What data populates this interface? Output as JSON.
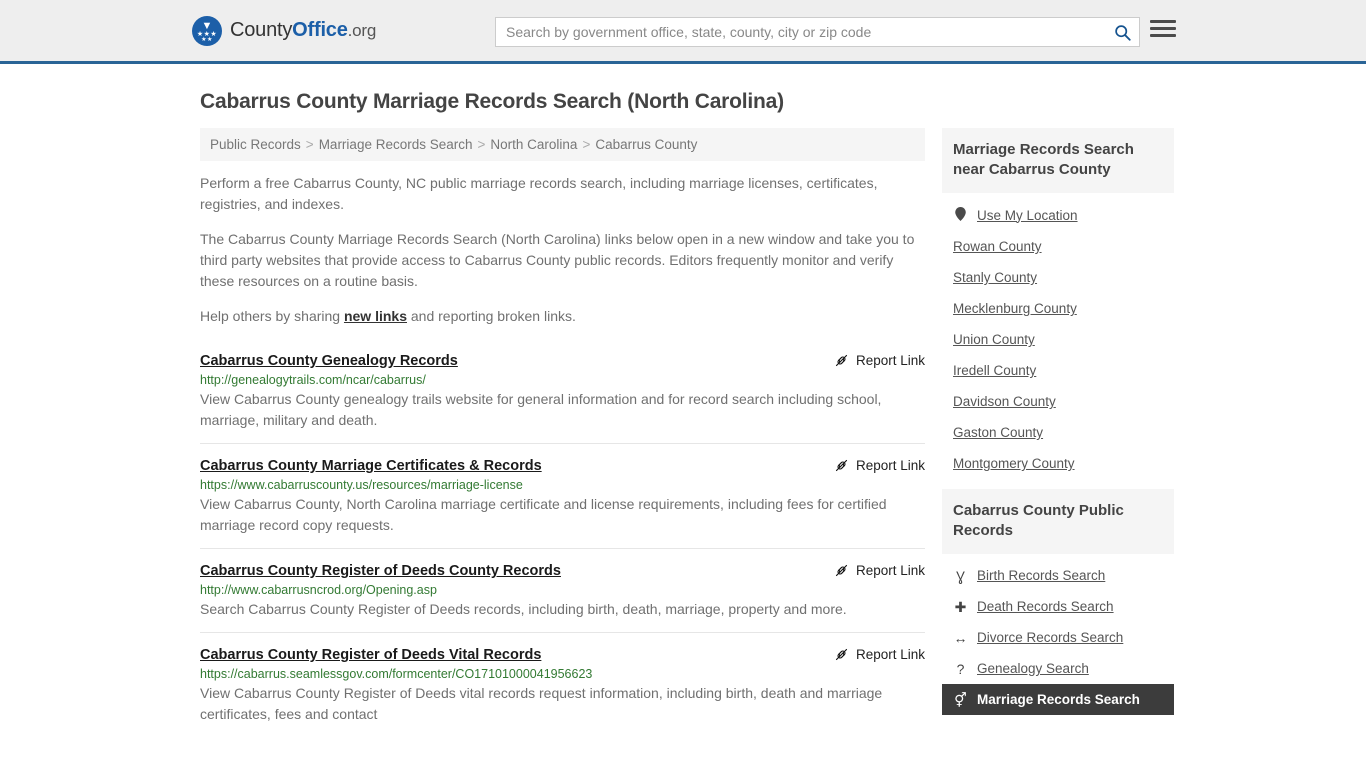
{
  "header": {
    "brand": {
      "part1": "County",
      "part2": "Office",
      "tld": ".org"
    },
    "search": {
      "placeholder": "Search by government office, state, county, city or zip code",
      "value": ""
    },
    "menu_icon": "hamburger-icon",
    "search_icon": "search-icon"
  },
  "page": {
    "title": "Cabarrus County Marriage Records Search (North Carolina)"
  },
  "breadcrumb": {
    "items": [
      {
        "label": "Public Records"
      },
      {
        "label": "Marriage Records Search"
      },
      {
        "label": "North Carolina"
      },
      {
        "label": "Cabarrus County"
      }
    ],
    "separator": ">"
  },
  "intro": {
    "p1": "Perform a free Cabarrus County, NC public marriage records search, including marriage licenses, certificates, registries, and indexes.",
    "p2": "The Cabarrus County Marriage Records Search (North Carolina) links below open in a new window and take you to third party websites that provide access to Cabarrus County public records. Editors frequently monitor and verify these resources on a routine basis.",
    "p3_before": "Help others by sharing ",
    "p3_link": "new links",
    "p3_after": " and reporting broken links."
  },
  "results": {
    "report_label": "Report Link",
    "report_icon": "unlink-icon",
    "items": [
      {
        "title": "Cabarrus County Genealogy Records",
        "url": "http://genealogytrails.com/ncar/cabarrus/",
        "desc": "View Cabarrus County genealogy trails website for general information and for record search including school, marriage, military and death."
      },
      {
        "title": "Cabarrus County Marriage Certificates & Records",
        "url": "https://www.cabarruscounty.us/resources/marriage-license",
        "desc": "View Cabarrus County, North Carolina marriage certificate and license requirements, including fees for certified marriage record copy requests."
      },
      {
        "title": "Cabarrus County Register of Deeds County Records",
        "url": "http://www.cabarrusncrod.org/Opening.asp",
        "desc": "Search Cabarrus County Register of Deeds records, including birth, death, marriage, property and more."
      },
      {
        "title": "Cabarrus County Register of Deeds Vital Records",
        "url": "https://cabarrus.seamlessgov.com/formcenter/CO17101000041956623",
        "desc": "View Cabarrus County Register of Deeds vital records request information, including birth, death and marriage certificates, fees and contact"
      }
    ]
  },
  "sidebar": {
    "nearby": {
      "heading": "Marriage Records Search near Cabarrus County",
      "items": [
        {
          "label": "Use My Location",
          "icon": "map-pin-icon",
          "glyph": "•",
          "active": false
        },
        {
          "label": "Rowan County",
          "icon": "",
          "glyph": "",
          "active": false
        },
        {
          "label": "Stanly County",
          "icon": "",
          "glyph": "",
          "active": false
        },
        {
          "label": "Mecklenburg County",
          "icon": "",
          "glyph": "",
          "active": false
        },
        {
          "label": "Union County",
          "icon": "",
          "glyph": "",
          "active": false
        },
        {
          "label": "Iredell County",
          "icon": "",
          "glyph": "",
          "active": false
        },
        {
          "label": "Davidson County",
          "icon": "",
          "glyph": "",
          "active": false
        },
        {
          "label": "Gaston County",
          "icon": "",
          "glyph": "",
          "active": false
        },
        {
          "label": "Montgomery County",
          "icon": "",
          "glyph": "",
          "active": false
        }
      ]
    },
    "public_records": {
      "heading": "Cabarrus County Public Records",
      "items": [
        {
          "label": "Birth Records Search",
          "icon": "baby-icon",
          "glyph": "Ɣ",
          "active": false
        },
        {
          "label": "Death Records Search",
          "icon": "cross-icon",
          "glyph": "✚",
          "active": false
        },
        {
          "label": "Divorce Records Search",
          "icon": "left-right-arrow-icon",
          "glyph": "↔",
          "active": false
        },
        {
          "label": "Genealogy Search",
          "icon": "question-mark-icon",
          "glyph": "?",
          "active": false
        },
        {
          "label": "Marriage Records Search",
          "icon": "venus-mars-icon",
          "glyph": "⚥",
          "active": true
        }
      ]
    }
  },
  "colors": {
    "header_bg": "#eeeeee",
    "header_border": "#2a6496",
    "brand_blue": "#1c5fa8",
    "url_green": "#337a33",
    "panel_gray": "#f5f5f5",
    "active_bg": "#3c3c3c"
  }
}
